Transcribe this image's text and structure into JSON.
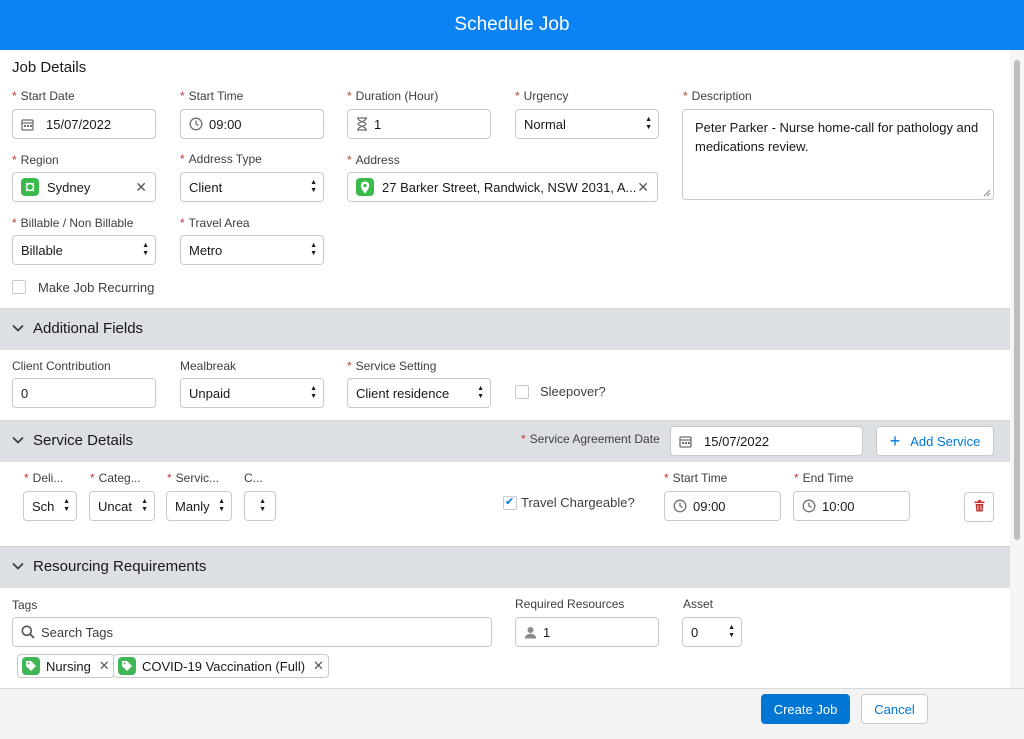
{
  "window": {
    "title": "Schedule Job"
  },
  "job_details": {
    "title": "Job Details",
    "start_date": {
      "label": "Start Date",
      "value": "15/07/2022"
    },
    "start_time": {
      "label": "Start Time",
      "value": "09:00"
    },
    "duration": {
      "label": "Duration (Hour)",
      "value": "1"
    },
    "urgency": {
      "label": "Urgency",
      "value": "Normal"
    },
    "description": {
      "label": "Description",
      "value": "Peter Parker - Nurse home-call for pathology and medications review."
    },
    "region": {
      "label": "Region",
      "value": "Sydney"
    },
    "address_type": {
      "label": "Address Type",
      "value": "Client"
    },
    "address": {
      "label": "Address",
      "value": "27 Barker Street, Randwick, NSW 2031, A..."
    },
    "billable": {
      "label": "Billable / Non Billable",
      "value": "Billable"
    },
    "travel_area": {
      "label": "Travel Area",
      "value": "Metro"
    },
    "recurring": {
      "label": "Make Job Recurring",
      "checked": false
    }
  },
  "additional_fields": {
    "title": "Additional Fields",
    "client_contribution": {
      "label": "Client Contribution",
      "value": "0"
    },
    "mealbreak": {
      "label": "Mealbreak",
      "value": "Unpaid"
    },
    "service_setting": {
      "label": "Service Setting",
      "value": "Client residence"
    },
    "sleepover": {
      "label": "Sleepover?",
      "checked": false
    }
  },
  "service_details": {
    "title": "Service Details",
    "agreement_date": {
      "label": "Service Agreement Date",
      "value": "15/07/2022"
    },
    "add_service_label": "Add Service",
    "row": {
      "col1": {
        "label": "Deli...",
        "value": "Sch"
      },
      "col2": {
        "label": "Categ...",
        "value": "Uncat"
      },
      "col3": {
        "label": "Servic...",
        "value": "Manly"
      },
      "col4": {
        "label": "C...",
        "value": ""
      },
      "travel_chargeable": {
        "label": "Travel Chargeable?",
        "checked": true
      },
      "start_time": {
        "label": "Start Time",
        "value": "09:00"
      },
      "end_time": {
        "label": "End Time",
        "value": "10:00"
      }
    }
  },
  "resourcing": {
    "title": "Resourcing Requirements",
    "tags_label": "Tags",
    "search_placeholder": "Search Tags",
    "required_resources": {
      "label": "Required Resources",
      "value": "1"
    },
    "asset": {
      "label": "Asset",
      "value": "0"
    },
    "tags": [
      "Nursing",
      "COVID-19 Vaccination (Full)"
    ]
  },
  "footer": {
    "create_label": "Create Job",
    "cancel_label": "Cancel"
  },
  "colors": {
    "header": "#0b83f5",
    "brand": "#0176d3",
    "region_icon": "#3bba4c",
    "tag_icon": "#41b658",
    "delete": "#c23934"
  },
  "icons": [
    "calendar-icon",
    "clock-icon",
    "hourglass-icon",
    "location-pin-icon",
    "region-icon",
    "chevron-down-icon",
    "plus-icon",
    "trash-icon",
    "search-icon",
    "user-icon",
    "tag-icon",
    "close-icon"
  ]
}
